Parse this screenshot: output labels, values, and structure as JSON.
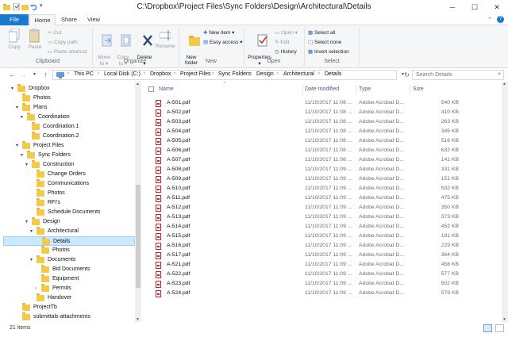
{
  "window": {
    "title": "C:\\Dropbox\\Project Files\\Sync Folders\\Design\\Architectural\\Details",
    "minimize": "─",
    "maximize": "☐",
    "close": "✕"
  },
  "ribbon_tabs": [
    "File",
    "Home",
    "Share",
    "View"
  ],
  "ribbon": {
    "clipboard": {
      "label": "Clipboard",
      "copy": "Copy",
      "paste": "Paste",
      "cut": "Cut",
      "copy_path": "Copy path",
      "paste_shortcut": "Paste shortcut"
    },
    "organize": {
      "label": "Organize",
      "move_to": "Move\nto ▾",
      "copy_to": "Copy\nto ▾",
      "delete": "Delete\n▾",
      "rename": "Rename"
    },
    "new": {
      "label": "New",
      "new_folder": "New\nfolder",
      "new_item": "New item ▾",
      "easy_access": "Easy access ▾"
    },
    "open": {
      "label": "Open",
      "properties": "Properties\n▾",
      "open": "Open ▾",
      "edit": "Edit",
      "history": "History"
    },
    "select": {
      "label": "Select",
      "select_all": "Select all",
      "select_none": "Select none",
      "invert": "Invert selection"
    }
  },
  "address": {
    "crumbs": [
      "This PC",
      "Local Disk (C:)",
      "Dropbox",
      "Project Files",
      "Sync Folders",
      "Design",
      "Architectural",
      "Details"
    ],
    "search_placeholder": "Search Details"
  },
  "nav_tree": [
    {
      "label": "Dropbox",
      "level": 0,
      "arrow": "▾"
    },
    {
      "label": "Photos",
      "level": 1,
      "arrow": ""
    },
    {
      "label": "Plans",
      "level": 1,
      "arrow": "▾"
    },
    {
      "label": "Coordination",
      "level": 2,
      "arrow": "▾"
    },
    {
      "label": "Coordination.1",
      "level": 3,
      "arrow": ""
    },
    {
      "label": "Coordination.2",
      "level": 3,
      "arrow": ""
    },
    {
      "label": "Project Files",
      "level": 1,
      "arrow": "▾"
    },
    {
      "label": "Sync Folders",
      "level": 2,
      "arrow": "▾"
    },
    {
      "label": "Construction",
      "level": 3,
      "arrow": "▾"
    },
    {
      "label": "Change Orders",
      "level": 4,
      "arrow": ""
    },
    {
      "label": "Communications",
      "level": 4,
      "arrow": ""
    },
    {
      "label": "Photos",
      "level": 4,
      "arrow": ""
    },
    {
      "label": "RFI's",
      "level": 4,
      "arrow": ""
    },
    {
      "label": "Schedule Documents",
      "level": 4,
      "arrow": ""
    },
    {
      "label": "Design",
      "level": 3,
      "arrow": "▾"
    },
    {
      "label": "Architectural",
      "level": 4,
      "arrow": "▾"
    },
    {
      "label": "Details",
      "level": 5,
      "arrow": "",
      "selected": true
    },
    {
      "label": "Photos",
      "level": 5,
      "arrow": ""
    },
    {
      "label": "Documents",
      "level": 4,
      "arrow": "▾"
    },
    {
      "label": "Bid Documents",
      "level": 5,
      "arrow": ""
    },
    {
      "label": "Equipment",
      "level": 5,
      "arrow": ""
    },
    {
      "label": "Permits",
      "level": 5,
      "arrow": "›"
    },
    {
      "label": "Handover",
      "level": 4,
      "arrow": ""
    },
    {
      "label": "ProjectTb",
      "level": 1,
      "arrow": ""
    },
    {
      "label": "submittals-attachments",
      "level": 1,
      "arrow": ""
    }
  ],
  "columns": {
    "name": "Name",
    "date": "Date modified",
    "type": "Type",
    "size": "Size"
  },
  "files": [
    {
      "name": "A-501.pdf",
      "date": "11/10/2017 11:08 ...",
      "type": "Adobe Acrobat D...",
      "size": "540 KB"
    },
    {
      "name": "A-502.pdf",
      "date": "11/10/2017 11:08 ...",
      "type": "Adobe Acrobat D...",
      "size": "410 KB"
    },
    {
      "name": "A-503.pdf",
      "date": "11/10/2017 11:08 ...",
      "type": "Adobe Acrobat D...",
      "size": "263 KB"
    },
    {
      "name": "A-504.pdf",
      "date": "11/10/2017 11:08 ...",
      "type": "Adobe Acrobat D...",
      "size": "345 KB"
    },
    {
      "name": "A-505.pdf",
      "date": "11/10/2017 11:08 ...",
      "type": "Adobe Acrobat D...",
      "size": "516 KB"
    },
    {
      "name": "A-506.pdf",
      "date": "11/10/2017 11:08 ...",
      "type": "Adobe Acrobat D...",
      "size": "632 KB"
    },
    {
      "name": "A-507.pdf",
      "date": "11/10/2017 11:08 ...",
      "type": "Adobe Acrobat D...",
      "size": "141 KB"
    },
    {
      "name": "A-508.pdf",
      "date": "11/10/2017 11:09 ...",
      "type": "Adobe Acrobat D...",
      "size": "331 KB"
    },
    {
      "name": "A-509.pdf",
      "date": "11/10/2017 11:09 ...",
      "type": "Adobe Acrobat D...",
      "size": "151 KB"
    },
    {
      "name": "A-510.pdf",
      "date": "11/10/2017 11:09 ...",
      "type": "Adobe Acrobat D...",
      "size": "532 KB"
    },
    {
      "name": "A-511.pdf",
      "date": "11/10/2017 11:09 ...",
      "type": "Adobe Acrobat D...",
      "size": "475 KB"
    },
    {
      "name": "A-512.pdf",
      "date": "11/10/2017 11:09 ...",
      "type": "Adobe Acrobat D...",
      "size": "350 KB"
    },
    {
      "name": "A-513.pdf",
      "date": "11/10/2017 11:09 ...",
      "type": "Adobe Acrobat D...",
      "size": "373 KB"
    },
    {
      "name": "A-514.pdf",
      "date": "11/10/2017 11:09 ...",
      "type": "Adobe Acrobat D...",
      "size": "452 KB"
    },
    {
      "name": "A-515.pdf",
      "date": "11/10/2017 11:09 ...",
      "type": "Adobe Acrobat D...",
      "size": "181 KB"
    },
    {
      "name": "A-516.pdf",
      "date": "11/10/2017 11:09 ...",
      "type": "Adobe Acrobat D...",
      "size": "229 KB"
    },
    {
      "name": "A-517.pdf",
      "date": "11/10/2017 11:09 ...",
      "type": "Adobe Acrobat D...",
      "size": "364 KB"
    },
    {
      "name": "A-521.pdf",
      "date": "11/10/2017 11:09 ...",
      "type": "Adobe Acrobat D...",
      "size": "458 KB"
    },
    {
      "name": "A-522.pdf",
      "date": "11/10/2017 11:09 ...",
      "type": "Adobe Acrobat D...",
      "size": "577 KB"
    },
    {
      "name": "A-523.pdf",
      "date": "11/10/2017 11:09 ...",
      "type": "Adobe Acrobat D...",
      "size": "502 KB"
    },
    {
      "name": "A-524.pdf",
      "date": "11/10/2017 11:09 ...",
      "type": "Adobe Acrobat D...",
      "size": "578 KB"
    }
  ],
  "status": {
    "item_count": "21 items"
  },
  "colors": {
    "accent": "#1979ca",
    "selection": "#cce8ff",
    "folder": "#f3c94c",
    "pdf": "#c8202b"
  }
}
